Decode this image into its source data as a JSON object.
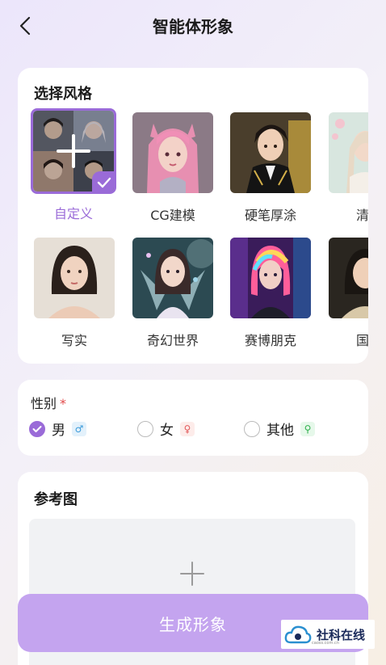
{
  "header": {
    "title": "智能体形象"
  },
  "style_section": {
    "title": "选择风格",
    "items": [
      {
        "label": "自定义"
      },
      {
        "label": "CG建模"
      },
      {
        "label": "硬笔厚涂"
      },
      {
        "label": "清新"
      },
      {
        "label": "写实"
      },
      {
        "label": "奇幻世界"
      },
      {
        "label": "赛博朋克"
      },
      {
        "label": "国风"
      }
    ],
    "selected_label": "自定义"
  },
  "gender_section": {
    "label": "性别",
    "required_mark": "*",
    "options": [
      {
        "label": "男",
        "symbol": "♂",
        "checked": true
      },
      {
        "label": "女",
        "symbol": "♀",
        "checked": false
      },
      {
        "label": "其他",
        "symbol": "⚲",
        "checked": false
      }
    ]
  },
  "reference_section": {
    "title": "参考图"
  },
  "generate_button": {
    "label": "生成形象"
  },
  "watermark": {
    "text": "社科在线",
    "url": "caoss.com.cn"
  },
  "colors": {
    "accent": "#9a6bd8",
    "button": "#c4a4ef",
    "upload_bg": "#f1f2f4"
  }
}
